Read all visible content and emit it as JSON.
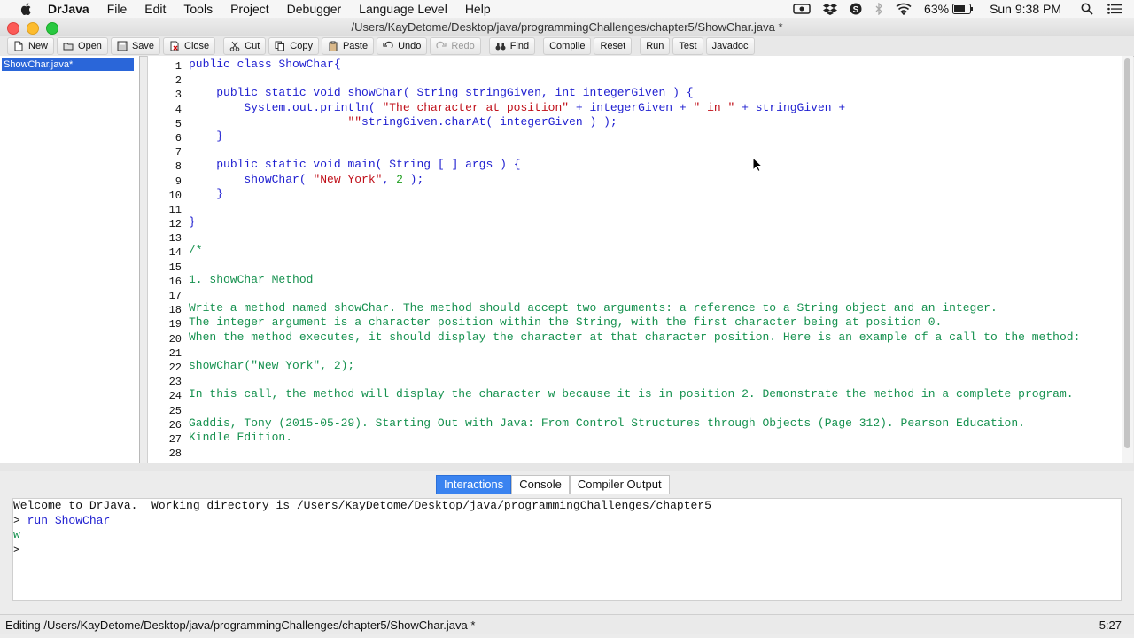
{
  "menubar": {
    "app": "DrJava",
    "items": [
      "File",
      "Edit",
      "Tools",
      "Project",
      "Debugger",
      "Language Level",
      "Help"
    ],
    "battery": "63%",
    "clock": "Sun 9:38 PM"
  },
  "window": {
    "title": "/Users/KayDetome/Desktop/java/programmingChallenges/chapter5/ShowChar.java *"
  },
  "toolbar": {
    "new": "New",
    "open": "Open",
    "save": "Save",
    "close": "Close",
    "cut": "Cut",
    "copy": "Copy",
    "paste": "Paste",
    "undo": "Undo",
    "redo": "Redo",
    "find": "Find",
    "compile": "Compile",
    "reset": "Reset",
    "run": "Run",
    "test": "Test",
    "javadoc": "Javadoc"
  },
  "files": {
    "open_file": "ShowChar.java*"
  },
  "editor": {
    "line_numbers": [
      "1",
      "2",
      "3",
      "4",
      "5",
      "6",
      "7",
      "8",
      "9",
      "10",
      "11",
      "12",
      "13",
      "14",
      "15",
      "16",
      "17",
      "18",
      "19",
      "20",
      "21",
      "22",
      "23",
      "24",
      "25",
      "26",
      "27",
      "28"
    ],
    "l1": {
      "kw": "public class",
      "rest": " ShowChar{"
    },
    "l3": {
      "kw1": "public static void",
      "rest1": " showChar( ",
      "kw2": "String",
      "rest2": " stringGiven, ",
      "kw3": "int",
      "rest3": " integerGiven ) {"
    },
    "l4": {
      "a": "System.out.println( ",
      "s1": "\"The character at position\"",
      "b": " + integerGiven + ",
      "s2": "\" in \"",
      "c": " + stringGiven +"
    },
    "l5": {
      "s": "\"\"",
      "rest": "stringGiven.charAt( integerGiven ) );"
    },
    "l6": "}",
    "l8": {
      "kw1": "public static void",
      "rest1": " main( ",
      "kw2": "String",
      "rest2": " [ ] args ) {"
    },
    "l9": {
      "a": "showChar( ",
      "s": "\"New York\"",
      "b": ", ",
      "n": "2",
      "c": " );"
    },
    "l10": "}",
    "l12": "}",
    "l14": "/*",
    "l16": "1. showChar Method",
    "l18": "Write a method named showChar. The method should accept two arguments: a reference to a String object and an integer.",
    "l19": "The integer argument is a character position within the String, with the first character being at position 0.",
    "l20": "When the method executes, it should display the character at that character position. Here is an example of a call to the method:",
    "l22": "showChar(\"New York\", 2);",
    "l24": "In this call, the method will display the character w because it is in position 2. Demonstrate the method in a complete program.",
    "l26": "Gaddis, Tony (2015-05-29). Starting Out with Java: From Control Structures through Objects (Page 312). Pearson Education.",
    "l27": "Kindle Edition."
  },
  "tabs": [
    "Interactions",
    "Console",
    "Compiler Output"
  ],
  "console": {
    "welcome": "Welcome to DrJava.  Working directory is /Users/KayDetome/Desktop/java/programmingChallenges/chapter5",
    "prompt": ">",
    "cmd": "run ShowChar",
    "output": "w"
  },
  "status": {
    "message": "Editing /Users/KayDetome/Desktop/java/programmingChallenges/chapter5/ShowChar.java *",
    "position": "5:27"
  }
}
